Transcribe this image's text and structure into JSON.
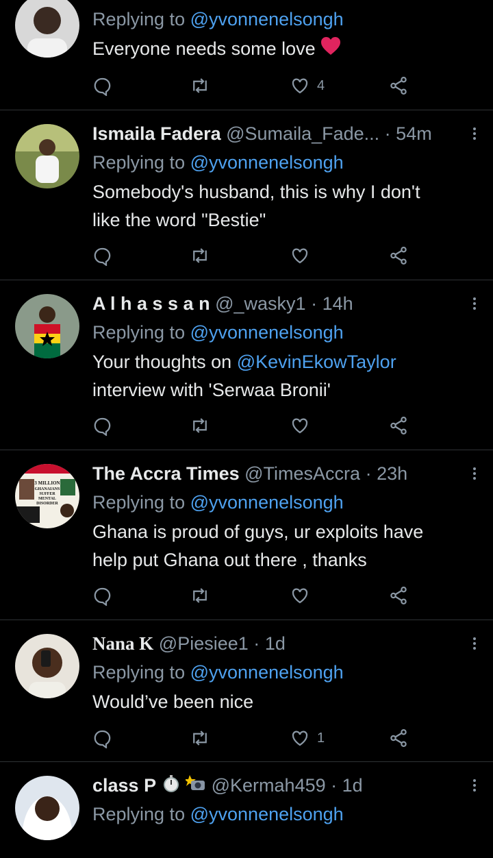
{
  "colors": {
    "background": "#000000",
    "text": "#e7e9ea",
    "secondary": "#8b98a5",
    "link": "#4ea1ef",
    "divider": "#2f3336",
    "heart": "#e0245e"
  },
  "tweets": [
    {
      "name": "",
      "handle": "",
      "time": "",
      "reply_label": "Replying to",
      "reply_to": "@yvonnenelsongh",
      "text_lines": [
        "Everyone needs some love"
      ],
      "text_emoji": "red-heart",
      "likes": "4",
      "avatar": "avatar-man-white-shirt"
    },
    {
      "name": "Ismaila Fadera",
      "handle": "@Sumaila_Fade...",
      "time": "54m",
      "reply_label": "Replying to",
      "reply_to": "@yvonnenelsongh",
      "text_lines": [
        "Somebody's husband, this is why I don't",
        "like the word \"Bestie\""
      ],
      "likes": "",
      "avatar": "avatar-man-outdoors"
    },
    {
      "name": "A l h a s s a n",
      "handle": "@_wasky1",
      "time": "14h",
      "reply_label": "Replying to",
      "reply_to": "@yvonnenelsongh",
      "text_prefix": "Your thoughts on ",
      "text_mention": "@KevinEkowTaylor",
      "text_line2": "interview with 'Serwaa Bronii'",
      "likes": "",
      "avatar": "avatar-man-ghana-shirt"
    },
    {
      "name": "The Accra Times",
      "handle": "@TimesAccra",
      "time": "23h",
      "reply_label": "Replying to",
      "reply_to": "@yvonnenelsongh",
      "text_lines": [
        "Ghana is proud of guys, ur exploits have",
        "help put Ghana out there , thanks"
      ],
      "likes": "",
      "avatar": "avatar-newspaper-logo",
      "avatar_text": [
        "3 MILLION",
        "GHANAIANS",
        "SUFFER",
        "MENTAL",
        "DISORDER"
      ]
    },
    {
      "name": "Nana K",
      "handle": "@Piesiee1",
      "time": "1d",
      "reply_label": "Replying to",
      "reply_to": "@yvonnenelsongh",
      "text_lines": [
        "Would’ve been nice"
      ],
      "likes": "1",
      "avatar": "avatar-man-selfie"
    },
    {
      "name": "class P",
      "name_emojis": [
        "stopwatch",
        "camera-flash"
      ],
      "handle": "@Kermah459",
      "time": "1d",
      "reply_label": "Replying to",
      "reply_to": "@yvonnenelsongh",
      "avatar": "avatar-man-hood"
    }
  ],
  "dot": "·",
  "icons": {
    "reply": "reply-icon",
    "retweet": "retweet-icon",
    "like": "heart-icon",
    "share": "share-icon",
    "more": "more-vertical-icon"
  }
}
